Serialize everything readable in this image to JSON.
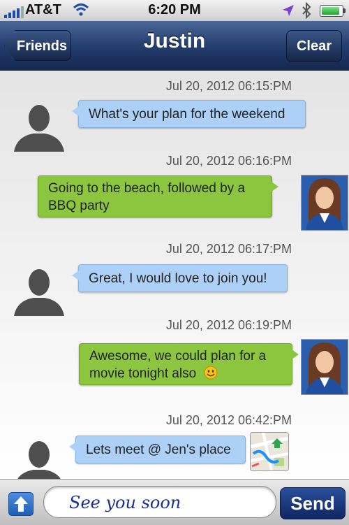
{
  "status_bar": {
    "carrier": "AT&T",
    "time": "6:20 PM",
    "battery_level": 0.9
  },
  "nav": {
    "title": "Justin",
    "back_label": "Friends",
    "clear_label": "Clear"
  },
  "messages": [
    {
      "timestamp": "Jul 20, 2012 06:15:PM",
      "text": "What's your plan for the weekend",
      "from": "friend"
    },
    {
      "timestamp": "Jul 20, 2012 06:16:PM",
      "text": "Going to the beach, followed by a BBQ party",
      "from": "me"
    },
    {
      "timestamp": "Jul 20, 2012 06:17:PM",
      "text": "Great, I would love to join you!",
      "from": "friend"
    },
    {
      "timestamp": "Jul 20, 2012 06:19:PM",
      "text": "Awesome, we could plan for a movie tonight also",
      "from": "me"
    },
    {
      "timestamp": "Jul 20, 2012 06:42:PM",
      "text": "Lets meet @ Jen's place",
      "from": "friend"
    }
  ],
  "composer": {
    "value": "See you soon",
    "send_label": "Send"
  },
  "colors": {
    "friend_bubble": "#acd0f6",
    "my_bubble": "#8cc63f",
    "nav_bar": "#243e6e"
  },
  "icons": [
    "signal-icon",
    "wifi-icon",
    "location-icon",
    "bluetooth-icon",
    "battery-icon",
    "smiley-icon",
    "map-icon",
    "up-arrow-icon"
  ]
}
